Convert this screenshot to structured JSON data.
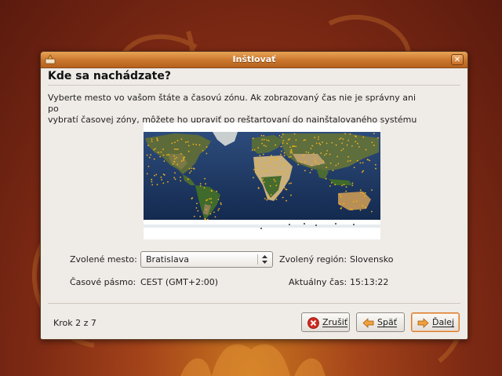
{
  "window": {
    "title": "Inštlovať",
    "heading": "Kde sa nachádzate?",
    "description_line1": "Vyberte mesto vo vašom štáte a časovú zónu. Ak zobrazovaný čas nie je správny ani po",
    "description_line2": "vybratí časovej zóny, môžete ho upraviť po reštartovaní do nainštalovaného systému"
  },
  "form": {
    "city_label": "Zvolené mesto:",
    "city_value": "Bratislava",
    "region_label": "Zvolený región:",
    "region_value": "Slovensko",
    "timezone_label": "Časové pásmo:",
    "timezone_value": "CEST (GMT+2:00)",
    "time_label": "Aktuálny čas:",
    "time_value": "15:13:22"
  },
  "footer": {
    "step": "Krok 2 z 7",
    "quit_label": "Zrušiť",
    "back_label": "Späť",
    "next_label": "Ďalej"
  },
  "colors": {
    "titlebar": "#c9752c",
    "window_bg": "#efebe7",
    "map_ocean": "#1f3a66",
    "city_dot": "#f2b31c"
  },
  "icons": {
    "app": "installer-icon",
    "close": "close-icon",
    "quit": "cancel-icon",
    "back": "arrow-left-icon",
    "next": "arrow-right-icon"
  }
}
